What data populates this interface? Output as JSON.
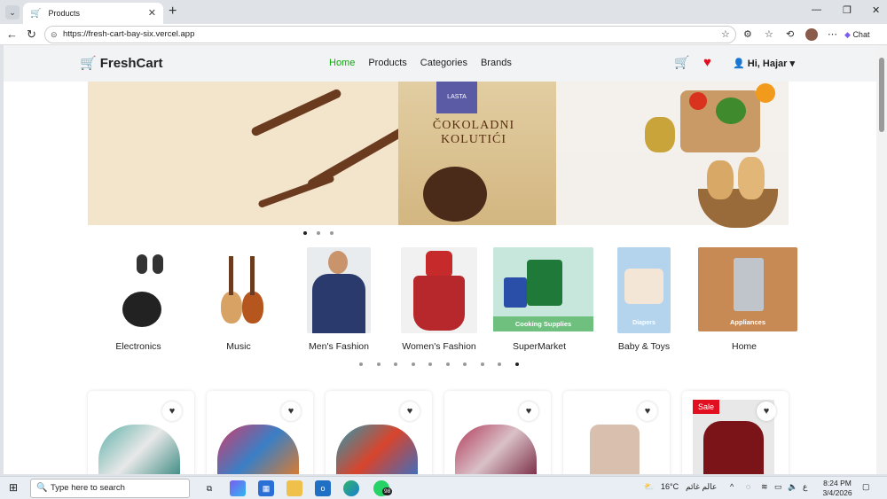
{
  "browser": {
    "tab_title": "Products",
    "url": "https://fresh-cart-bay-six.vercel.app",
    "chat_label": "Chat"
  },
  "site": {
    "logo": "FreshCart",
    "nav": [
      "Home",
      "Products",
      "Categories",
      "Brands"
    ],
    "active_nav": "Home",
    "user_greeting": "Hi, Hajar"
  },
  "hero": {
    "brand": "LASTA",
    "product_name": "ČOKOLADNI KOLUTIĆI",
    "slide_count": 3,
    "active_slide": 0
  },
  "categories": {
    "items": [
      {
        "label": "Electronics"
      },
      {
        "label": "Music"
      },
      {
        "label": "Men's Fashion"
      },
      {
        "label": "Women's Fashion"
      },
      {
        "label": "SuperMarket",
        "image_caption": "Cooking Supplies"
      },
      {
        "label": "Baby & Toys",
        "image_caption": "Diapers"
      },
      {
        "label": "Home",
        "image_caption": "Appliances"
      }
    ],
    "pager_count": 10,
    "active_page": 9
  },
  "products": {
    "cards": [
      {
        "sale": false
      },
      {
        "sale": false
      },
      {
        "sale": false
      },
      {
        "sale": false
      },
      {
        "sale": false
      },
      {
        "sale": true,
        "badge": "Sale"
      }
    ]
  },
  "taskbar": {
    "search_placeholder": "Type here to search",
    "weather": "16°C",
    "weather_text": "عالم غائم",
    "time": "8:24 PM",
    "date": "3/4/2026",
    "lang": "ع",
    "whatsapp_badge": "98"
  },
  "colors": {
    "brand_green": "#0aad0a",
    "heart_red": "#e10f1f"
  }
}
